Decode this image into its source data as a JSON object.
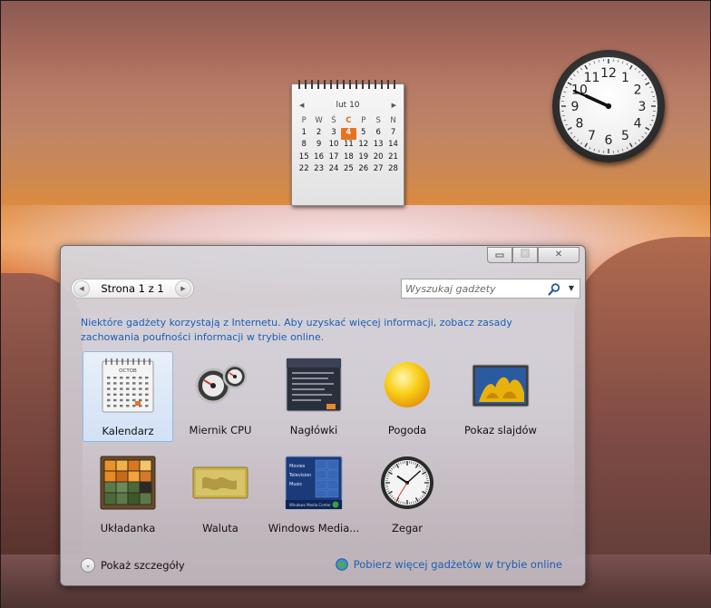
{
  "colors": {
    "link": "#1b5fb5",
    "calendar_today": "#e8721f",
    "selection": "#93b7e2"
  },
  "desktop_calendar": {
    "month": "lut 10",
    "weekday_headers": [
      "P",
      "W",
      "Ś",
      "C",
      "P",
      "S",
      "N"
    ],
    "weeks": [
      [
        "1",
        "2",
        "3",
        "4",
        "5",
        "6",
        "7"
      ],
      [
        "8",
        "9",
        "10",
        "11",
        "12",
        "13",
        "14"
      ],
      [
        "15",
        "16",
        "17",
        "18",
        "19",
        "20",
        "21"
      ],
      [
        "22",
        "23",
        "24",
        "25",
        "26",
        "27",
        "28"
      ]
    ],
    "today": "4"
  },
  "desktop_clock": {
    "numerals": [
      "12",
      "1",
      "2",
      "3",
      "4",
      "5",
      "6",
      "7",
      "8",
      "9",
      "10",
      "11"
    ],
    "time": "9:49"
  },
  "window": {
    "controls": {
      "minimize_icon": "minimize-icon",
      "maximize_icon": "maximize-icon",
      "close_glyph": "✕"
    },
    "pager": {
      "label": "Strona 1 z 1",
      "prev_icon": "◀",
      "next_icon": "▶"
    },
    "search": {
      "placeholder": "Wyszukaj gadżety",
      "value": "",
      "dropdown_icon": "▼"
    },
    "info_text": "Niektóre gadżety korzystają z Internetu. Aby uzyskać więcej informacji, zobacz zasady zachowania poufności informacji w trybie online.",
    "gadgets": [
      {
        "label": "Kalendarz",
        "icon": "calendar-icon",
        "selected": true
      },
      {
        "label": "Miernik CPU",
        "icon": "cpu-meter-icon",
        "selected": false
      },
      {
        "label": "Nagłówki",
        "icon": "headlines-icon",
        "selected": false
      },
      {
        "label": "Pogoda",
        "icon": "weather-sun-icon",
        "selected": false
      },
      {
        "label": "Pokaz slajdów",
        "icon": "slideshow-icon",
        "selected": false
      },
      {
        "label": "Układanka",
        "icon": "puzzle-icon",
        "selected": false
      },
      {
        "label": "Waluta",
        "icon": "currency-icon",
        "selected": false
      },
      {
        "label": "Windows Media...",
        "icon": "media-center-icon",
        "selected": false
      },
      {
        "label": "Zegar",
        "icon": "clock-icon",
        "selected": false
      }
    ],
    "thumb_texts": {
      "calendar_month": "OCTOB",
      "media_items": [
        "Movies",
        "Television",
        "Music"
      ],
      "media_footer": "Windows Media Center"
    },
    "footer": {
      "details_label": "Pokaż szczegóły",
      "details_icon": "⌄",
      "more_link": "Pobierz więcej gadżetów w trybie online"
    }
  }
}
